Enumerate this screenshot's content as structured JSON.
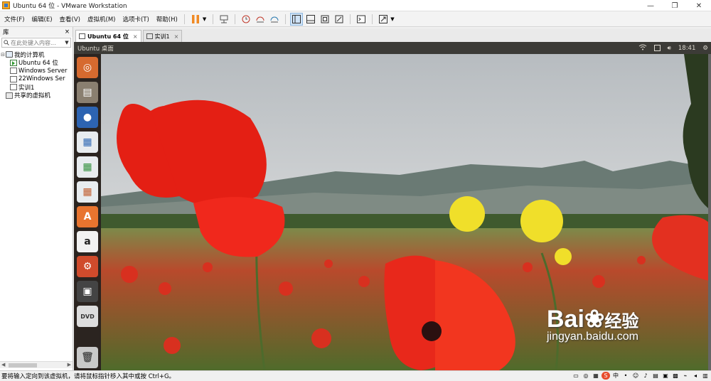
{
  "window": {
    "title": "Ubuntu 64 位 - VMware Workstation"
  },
  "menu": [
    "文件(F)",
    "编辑(E)",
    "查看(V)",
    "虚拟机(M)",
    "选项卡(T)",
    "帮助(H)"
  ],
  "library": {
    "header": "库",
    "close": "×",
    "search_placeholder": "在此处键入内容...",
    "tree": [
      {
        "label": "我的计算机",
        "level": 0,
        "icon": "computer-icon"
      },
      {
        "label": "Ubuntu 64 位",
        "level": 1,
        "icon": "vm-running-icon"
      },
      {
        "label": "Windows Server",
        "level": 1,
        "icon": "vm-icon"
      },
      {
        "label": "22Windows Ser",
        "level": 1,
        "icon": "vm-icon"
      },
      {
        "label": "实训1",
        "level": 1,
        "icon": "vm-icon"
      },
      {
        "label": "共享的虚拟机",
        "level": 0,
        "icon": "shared-vm-icon"
      }
    ]
  },
  "tabs": [
    {
      "label": "Ubuntu 64 位",
      "active": true
    },
    {
      "label": "实训1",
      "active": false
    }
  ],
  "guest": {
    "panel_title": "Ubuntu 桌面",
    "clock": "18:41",
    "launcher": [
      "ubuntu-dash-icon",
      "files-icon",
      "firefox-icon",
      "writer-icon",
      "calc-icon",
      "impress-icon",
      "software-center-icon",
      "amazon-icon",
      "settings-icon",
      "save-icon",
      "dvd-icon",
      "trash-icon"
    ]
  },
  "watermark": {
    "brand": "Bai",
    "brand_suffix": "经验",
    "url": "jingyan.baidu.com"
  },
  "status": {
    "message": "要将输入定向到该虚拟机，请将鼠标指针移入其中或按 Ctrl+G。"
  },
  "colors": {
    "panel": "#3c3b37",
    "launcher": "#3c322d",
    "poppy": "#e8261a",
    "accent": "#f5a623"
  }
}
